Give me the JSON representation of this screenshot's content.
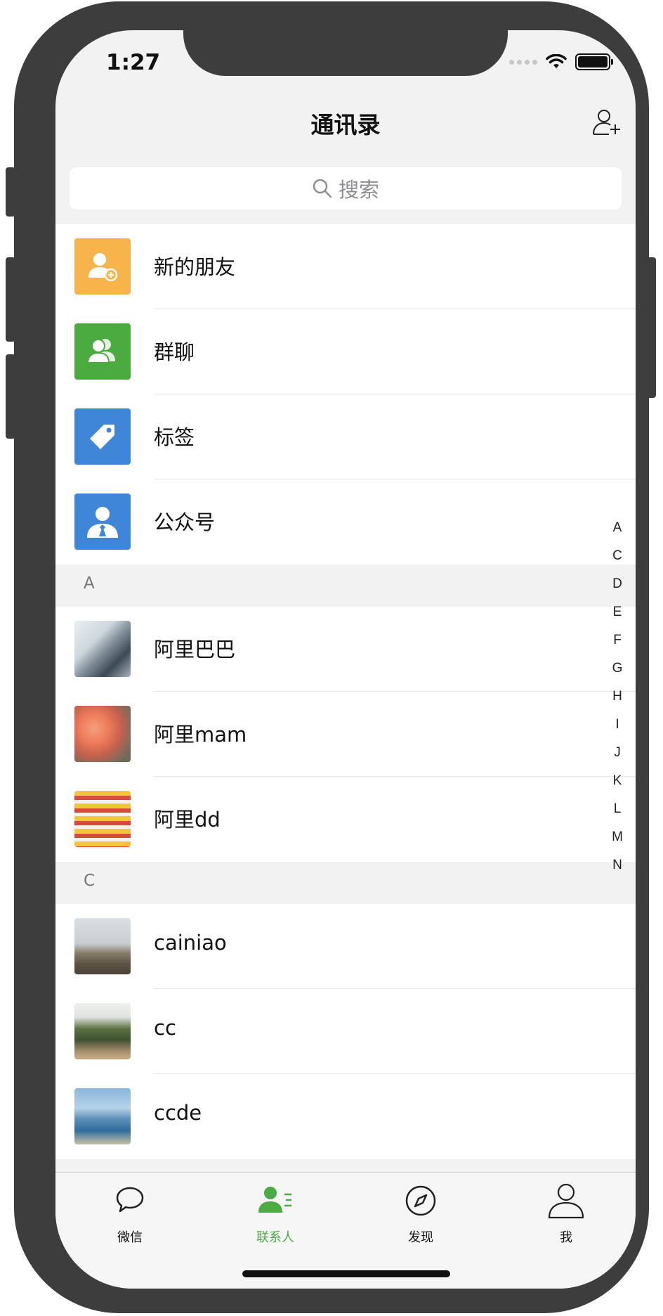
{
  "status_bar": {
    "time": "1:27"
  },
  "nav": {
    "title": "通讯录"
  },
  "search": {
    "placeholder": "搜索"
  },
  "top_items": [
    {
      "label": "新的朋友",
      "icon": "add-friend-icon",
      "color": "#f6b44b"
    },
    {
      "label": "群聊",
      "icon": "group-icon",
      "color": "#4bab3f"
    },
    {
      "label": "标签",
      "icon": "tag-icon",
      "color": "#3f86d9"
    },
    {
      "label": "公众号",
      "icon": "official-account-icon",
      "color": "#3f86d9"
    }
  ],
  "sections": [
    {
      "letter": "A",
      "contacts": [
        {
          "name": "阿里巴巴"
        },
        {
          "name": "阿里mam"
        },
        {
          "name": "阿里dd"
        }
      ]
    },
    {
      "letter": "C",
      "contacts": [
        {
          "name": "cainiao"
        },
        {
          "name": "cc"
        },
        {
          "name": "ccde"
        }
      ]
    }
  ],
  "index_letters": [
    "A",
    "C",
    "D",
    "E",
    "F",
    "G",
    "H",
    "I",
    "J",
    "K",
    "L",
    "M",
    "N"
  ],
  "tabbar": [
    {
      "label": "微信",
      "icon": "chat-icon",
      "active": false
    },
    {
      "label": "联系人",
      "icon": "contacts-icon",
      "active": true
    },
    {
      "label": "发现",
      "icon": "compass-icon",
      "active": false
    },
    {
      "label": "我",
      "icon": "profile-icon",
      "active": false
    }
  ],
  "colors": {
    "accent": "#4cab44"
  }
}
